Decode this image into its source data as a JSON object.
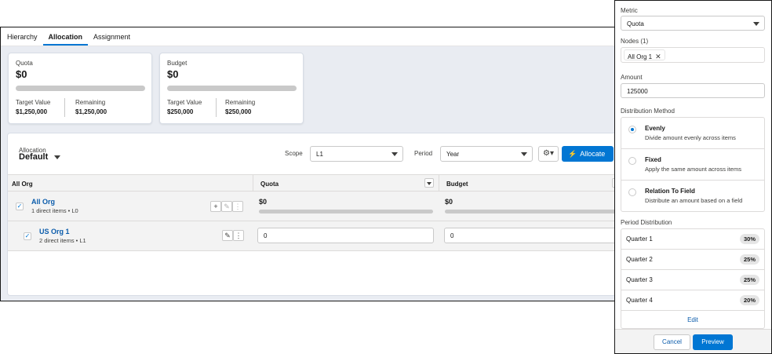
{
  "tabs": [
    {
      "label": "Hierarchy",
      "active": false
    },
    {
      "label": "Allocation",
      "active": true
    },
    {
      "label": "Assignment",
      "active": false
    }
  ],
  "cards": {
    "quota": {
      "label": "Quota",
      "value": "$0",
      "target_label": "Target Value",
      "target_value": "$1,250,000",
      "remaining_label": "Remaining",
      "remaining_value": "$1,250,000"
    },
    "budget": {
      "label": "Budget",
      "value": "$0",
      "target_label": "Target Value",
      "target_value": "$250,000",
      "remaining_label": "Remaining",
      "remaining_value": "$250,000"
    }
  },
  "allocation": {
    "label": "Allocation",
    "value": "Default",
    "scope_label": "Scope",
    "scope_value": "L1",
    "period_label": "Period",
    "period_value": "Year",
    "allocate_button": "Allocate"
  },
  "table": {
    "headers": [
      "All Org",
      "Quota",
      "Budget"
    ],
    "rows": [
      {
        "name": "All Org",
        "sub": "1 direct items • L0",
        "quota": "$0",
        "budget": "$0"
      },
      {
        "name": "US Org 1",
        "sub": "2 direct items • L1",
        "quota": "0",
        "budget": "0"
      }
    ]
  },
  "drawer": {
    "metric_label": "Metric",
    "metric_value": "Quota",
    "nodes_label": "Nodes (1)",
    "node_pill": "All Org 1",
    "amount_label": "Amount",
    "amount_value": "125000",
    "distribution_label": "Distribution Method",
    "options": [
      {
        "title": "Evenly",
        "desc": "Divide amount evenly across items",
        "selected": true
      },
      {
        "title": "Fixed",
        "desc": "Apply the same amount across items",
        "selected": false
      },
      {
        "title": "Relation To Field",
        "desc": "Distribute an amount based on a field",
        "selected": false
      }
    ],
    "period_dist_label": "Period Distribution",
    "periods": [
      {
        "name": "Quarter 1",
        "pct": "30%"
      },
      {
        "name": "Quarter 2",
        "pct": "25%"
      },
      {
        "name": "Quarter 3",
        "pct": "25%"
      },
      {
        "name": "Quarter 4",
        "pct": "20%"
      }
    ],
    "edit_label": "Edit",
    "cancel_label": "Cancel",
    "preview_label": "Preview"
  },
  "colors": {
    "brand": "#0176d3",
    "link": "#0b5cab",
    "background": "#e9ecf2"
  },
  "icons": {
    "allocate": "magic-wand-icon",
    "settings": "gear-icon",
    "remove": "close-icon",
    "add": "plus-icon",
    "edit": "pencil-icon",
    "more": "more-vertical-icon"
  }
}
